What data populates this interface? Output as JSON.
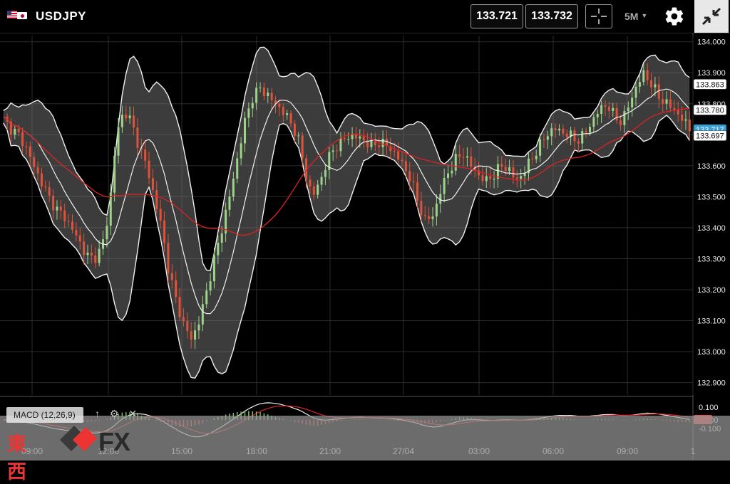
{
  "header": {
    "symbol": "USDJPY",
    "bid": "133.721",
    "ask": "133.732",
    "timeframe": "5M",
    "icons": [
      "flag-us-icon",
      "flag-jp-icon",
      "crosshair-icon",
      "gear-icon",
      "shrink-icon"
    ]
  },
  "chart_data": {
    "type": "candlestick",
    "symbol": "USDJPY",
    "timeframe": "5M",
    "y_ticks": [
      "134.000",
      "133.900",
      "133.800",
      "133.700",
      "133.600",
      "133.500",
      "133.400",
      "133.300",
      "133.200",
      "133.100",
      "133.000",
      "132.900"
    ],
    "x_ticks": [
      "09:00",
      "12:00",
      "15:00",
      "18:00",
      "21:00",
      "27/04",
      "03:00",
      "06:00",
      "09:00",
      "1"
    ],
    "ylim": [
      132.86,
      134.02
    ],
    "indicators": [
      "Bollinger Bands",
      "Moving Average",
      "MACD (12,26,9)"
    ],
    "price_tags": [
      {
        "value": "133.863",
        "kind": "upper-band",
        "color": "#ffffff"
      },
      {
        "value": "133.780",
        "kind": "moving-average",
        "color": "#ffffff"
      },
      {
        "value": "133.717",
        "kind": "last-price",
        "color": "#3aa0d8"
      },
      {
        "value": "133.697",
        "kind": "lower-band",
        "color": "#ffffff"
      }
    ],
    "price_path": [
      133.75,
      133.72,
      133.7,
      133.66,
      133.6,
      133.55,
      133.5,
      133.46,
      133.44,
      133.4,
      133.36,
      133.31,
      133.3,
      133.33,
      133.45,
      133.7,
      133.78,
      133.74,
      133.66,
      133.6,
      133.5,
      133.4,
      133.25,
      133.16,
      133.08,
      133.04,
      133.1,
      133.2,
      133.3,
      133.4,
      133.5,
      133.62,
      133.74,
      133.82,
      133.85,
      133.83,
      133.8,
      133.78,
      133.74,
      133.7,
      133.58,
      133.5,
      133.55,
      133.62,
      133.66,
      133.68,
      133.7,
      133.69,
      133.68,
      133.66,
      133.68,
      133.66,
      133.64,
      133.6,
      133.56,
      133.48,
      133.42,
      133.44,
      133.52,
      133.58,
      133.62,
      133.64,
      133.6,
      133.57,
      133.55,
      133.57,
      133.6,
      133.59,
      133.55,
      133.58,
      133.62,
      133.66,
      133.7,
      133.72,
      133.71,
      133.7,
      133.68,
      133.7,
      133.74,
      133.78,
      133.8,
      133.76,
      133.74,
      133.8,
      133.86,
      133.9,
      133.86,
      133.82,
      133.8,
      133.78,
      133.75,
      133.72
    ],
    "macd_ticks": [
      "0.100",
      "0.000",
      "-0.100"
    ],
    "macd_label": "MACD (12,26,9)"
  },
  "macd": {
    "legend": "MACD (12,26,9)",
    "up_icon": "↑",
    "settings_icon": "⚙",
    "close_icon": "✕",
    "zero_tag": "0.000"
  },
  "brand": {
    "japanese": "東西",
    "fx": "FX",
    "logo_color": "#e33333"
  }
}
